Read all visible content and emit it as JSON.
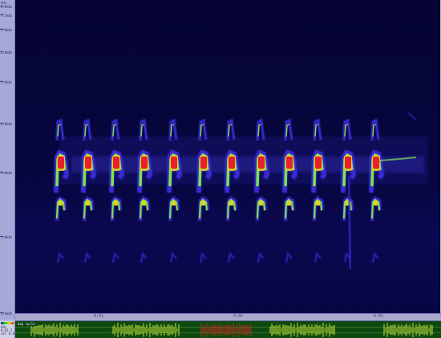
{
  "ruler": {
    "header": "kHz",
    "ticks": [
      {
        "label": "8.0kHz"
      },
      {
        "label": "7.5kHz"
      },
      {
        "label": "7.0kHz"
      },
      {
        "label": "6.0kHz"
      },
      {
        "label": "5.0kHz"
      },
      {
        "label": "4.0kHz"
      },
      {
        "label": "3.0kHz"
      },
      {
        "label": "2.0kHz"
      },
      {
        "label": "0.0kHz"
      }
    ]
  },
  "timebar": {
    "ticks": [
      "0:01",
      "0:02",
      "0:03"
    ]
  },
  "bottom": {
    "mini_lines": [
      "kHz",
      "0:01.5",
      "sel 0.0"
    ],
    "track_label": "bep cycle"
  },
  "colors": {
    "background": "#050434",
    "low": "#3b2bd6",
    "mid": "#7ee34a",
    "high": "#e0d12a",
    "peak": "#e8202a",
    "waveform": "#c7e23a",
    "waveform_selected": "#c7281e",
    "waveform_bg": "#0e4a10"
  }
}
